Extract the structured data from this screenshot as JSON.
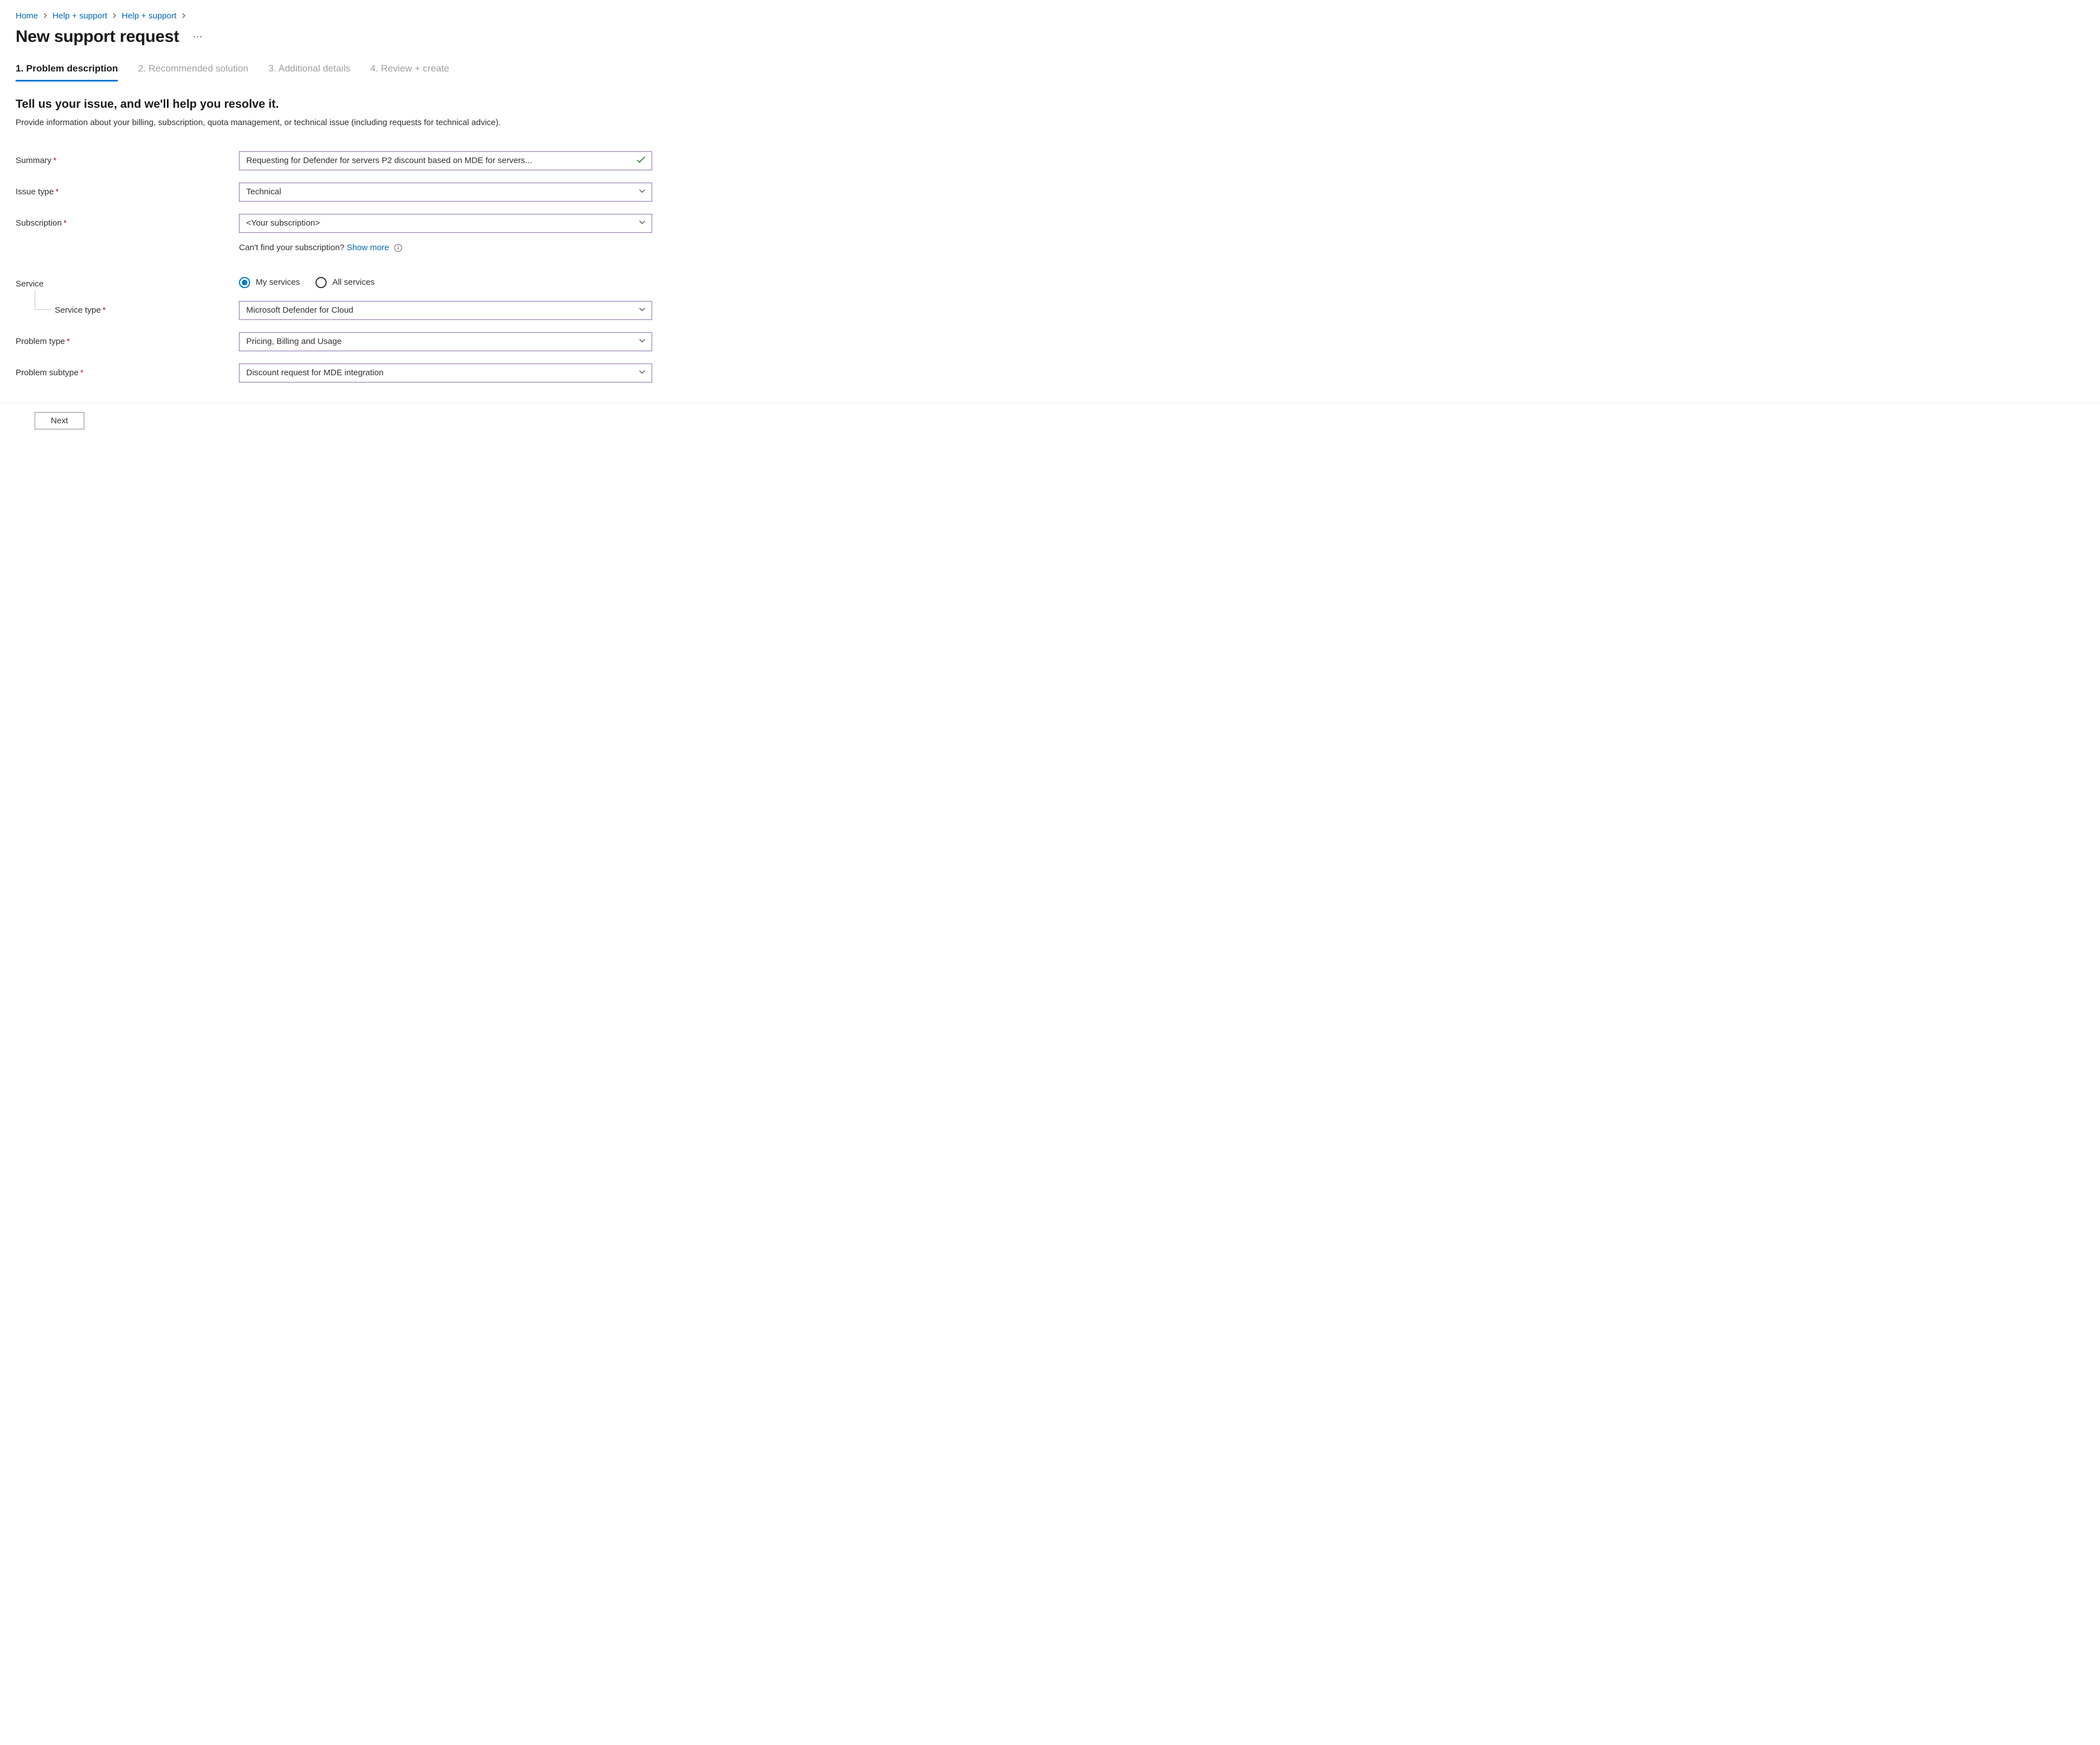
{
  "breadcrumb": {
    "items": [
      {
        "label": "Home"
      },
      {
        "label": "Help + support"
      },
      {
        "label": "Help + support"
      }
    ]
  },
  "pageTitle": "New support request",
  "tabs": [
    {
      "label": "1. Problem description",
      "active": true
    },
    {
      "label": "2. Recommended solution",
      "active": false
    },
    {
      "label": "3. Additional details",
      "active": false
    },
    {
      "label": "4. Review + create",
      "active": false
    }
  ],
  "section": {
    "heading": "Tell us your issue, and we'll help you resolve it.",
    "description": "Provide information about your billing, subscription, quota management, or technical issue (including requests for technical advice)."
  },
  "form": {
    "summary": {
      "label": "Summary",
      "value": "Requesting for Defender for servers P2 discount based on MDE for servers..."
    },
    "issueType": {
      "label": "Issue type",
      "value": "Technical"
    },
    "subscription": {
      "label": "Subscription",
      "value": "<Your subscription>",
      "helpText": "Can't find your subscription? ",
      "helpLink": "Show more"
    },
    "service": {
      "label": "Service",
      "options": [
        {
          "label": "My services",
          "selected": true
        },
        {
          "label": "All services",
          "selected": false
        }
      ]
    },
    "serviceType": {
      "label": "Service type",
      "value": "Microsoft Defender for Cloud"
    },
    "problemType": {
      "label": "Problem type",
      "value": "Pricing, Billing and Usage"
    },
    "problemSubtype": {
      "label": "Problem subtype",
      "value": "Discount request for MDE integration"
    }
  },
  "footer": {
    "nextButton": "Next"
  }
}
